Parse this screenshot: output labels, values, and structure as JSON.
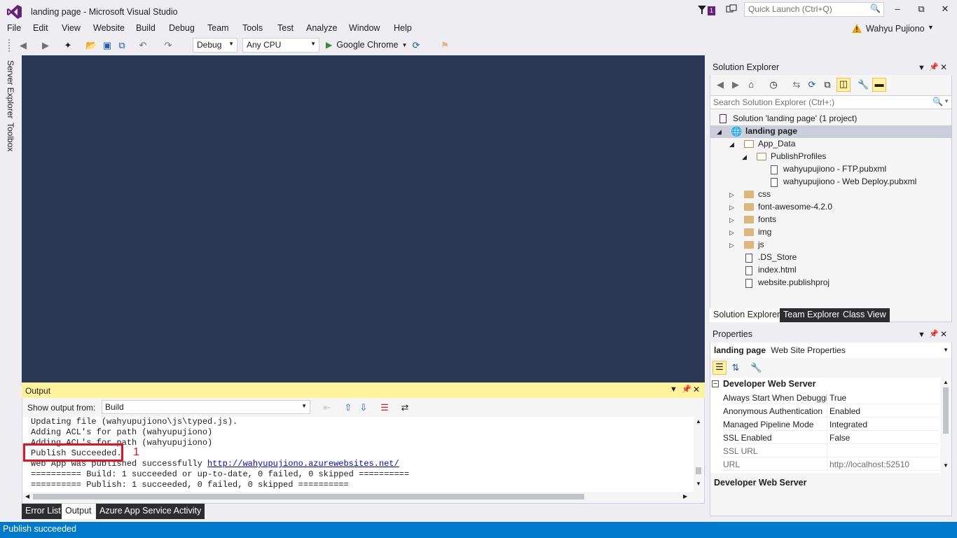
{
  "window": {
    "title": "landing page - Microsoft Visual Studio",
    "notifications_count": "1",
    "quick_launch_placeholder": "Quick Launch (Ctrl+Q)",
    "user": "Wahyu Pujiono",
    "minimize": "–",
    "maximize": "⧉",
    "close": "✕"
  },
  "menu": [
    "File",
    "Edit",
    "View",
    "Website",
    "Build",
    "Debug",
    "Team",
    "Tools",
    "Test",
    "Analyze",
    "Window",
    "Help"
  ],
  "toolbar": {
    "config": "Debug",
    "platform": "Any CPU",
    "run_target": "Google Chrome"
  },
  "side_tabs": [
    "Server Explorer",
    "Toolbox"
  ],
  "output": {
    "title": "Output",
    "show_from_label": "Show output from:",
    "source": "Build",
    "lines": [
      "Updating file (wahyupujiono\\js\\typed.js).",
      "Adding ACL's for path (wahyupujiono)",
      "Adding ACL's for path (wahyupujiono)",
      "Publish Succeeded.",
      "Web App was published successfully ",
      "========== Build: 1 succeeded or up-to-date, 0 failed, 0 skipped ==========",
      "========== Publish: 1 succeeded, 0 failed, 0 skipped =========="
    ],
    "link": "http://wahyupujiono.azurewebsites.net/",
    "annotation": "1"
  },
  "bottom_tabs": [
    {
      "label": "Error List",
      "active": false
    },
    {
      "label": "Output",
      "active": true
    },
    {
      "label": "Azure App Service Activity",
      "active": false
    }
  ],
  "solution_explorer": {
    "title": "Solution Explorer",
    "search_placeholder": "Search Solution Explorer (Ctrl+;)",
    "tree": {
      "solution": "Solution 'landing page' (1 project)",
      "project": "landing page",
      "app_data": "App_Data",
      "publish_profiles": "PublishProfiles",
      "ftp": "wahyupujiono - FTP.pubxml",
      "webdeploy": "wahyupujiono - Web Deploy.pubxml",
      "css": "css",
      "fontawesome": "font-awesome-4.2.0",
      "fonts": "fonts",
      "img": "img",
      "js": "js",
      "ds_store": ".DS_Store",
      "index": "index.html",
      "publishproj": "website.publishproj"
    },
    "tabs": [
      {
        "label": "Solution Explorer",
        "active": true
      },
      {
        "label": "Team Explorer",
        "active": false
      },
      {
        "label": "Class View",
        "active": false
      }
    ]
  },
  "properties": {
    "title": "Properties",
    "object_name": "landing page",
    "object_type": "Web Site Properties",
    "category": "Developer Web Server",
    "rows": [
      {
        "name": "Always Start When Debuggi",
        "value": "True"
      },
      {
        "name": "Anonymous Authentication",
        "value": "Enabled"
      },
      {
        "name": "Managed Pipeline Mode",
        "value": "Integrated"
      },
      {
        "name": "SSL Enabled",
        "value": "False"
      },
      {
        "name": "SSL URL",
        "value": ""
      },
      {
        "name": "URL",
        "value": "http://localhost:52510"
      }
    ],
    "description_title": "Developer Web Server"
  },
  "status": "Publish succeeded",
  "colors": {
    "accent": "#007ACC",
    "editor_bg": "#293955",
    "vs_purple": "#68217A",
    "output_header": "#FFF29D",
    "highlight_red": "#E81123"
  }
}
